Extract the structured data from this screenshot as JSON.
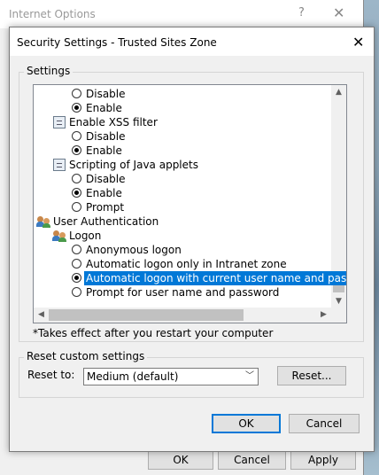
{
  "parent_window": {
    "title": "Internet Options",
    "help_glyph": "?",
    "close_glyph": "✕",
    "buttons": {
      "ok": "OK",
      "cancel": "Cancel",
      "apply": "Apply"
    }
  },
  "dialog": {
    "title": "Security Settings - Trusted Sites Zone",
    "close_glyph": "✕",
    "settings_group_label": "Settings",
    "settings_tree": [
      {
        "type": "radio",
        "label": "Disable",
        "checked": false
      },
      {
        "type": "radio",
        "label": "Enable",
        "checked": true
      },
      {
        "type": "category",
        "label": "Enable XSS filter"
      },
      {
        "type": "radio",
        "label": "Disable",
        "checked": false
      },
      {
        "type": "radio",
        "label": "Enable",
        "checked": true
      },
      {
        "type": "category",
        "label": "Scripting of Java applets"
      },
      {
        "type": "radio",
        "label": "Disable",
        "checked": false
      },
      {
        "type": "radio",
        "label": "Enable",
        "checked": true
      },
      {
        "type": "radio",
        "label": "Prompt",
        "checked": false
      },
      {
        "type": "users",
        "label": "User Authentication"
      },
      {
        "type": "users",
        "label": "Logon"
      },
      {
        "type": "radio",
        "label": "Anonymous logon",
        "checked": false
      },
      {
        "type": "radio",
        "label": "Automatic logon only in Intranet zone",
        "checked": false
      },
      {
        "type": "radio",
        "label": "Automatic logon with current user name and password",
        "checked": true,
        "selected": true
      },
      {
        "type": "radio",
        "label": "Prompt for user name and password",
        "checked": false
      }
    ],
    "note": "*Takes effect after you restart your computer",
    "reset_group_label": "Reset custom settings",
    "reset_to_label": "Reset to:",
    "reset_select_value": "Medium (default)",
    "reset_button": "Reset...",
    "ok_button": "OK",
    "cancel_button": "Cancel"
  },
  "icons": {
    "category": "settings-list-icon",
    "users": "users-icon",
    "scroll_up": "▲",
    "scroll_down": "▼",
    "scroll_left": "◀",
    "scroll_right": "▶",
    "dropdown": "﹀"
  },
  "colors": {
    "selection": "#0078d7",
    "default_button_border": "#0078d7"
  }
}
